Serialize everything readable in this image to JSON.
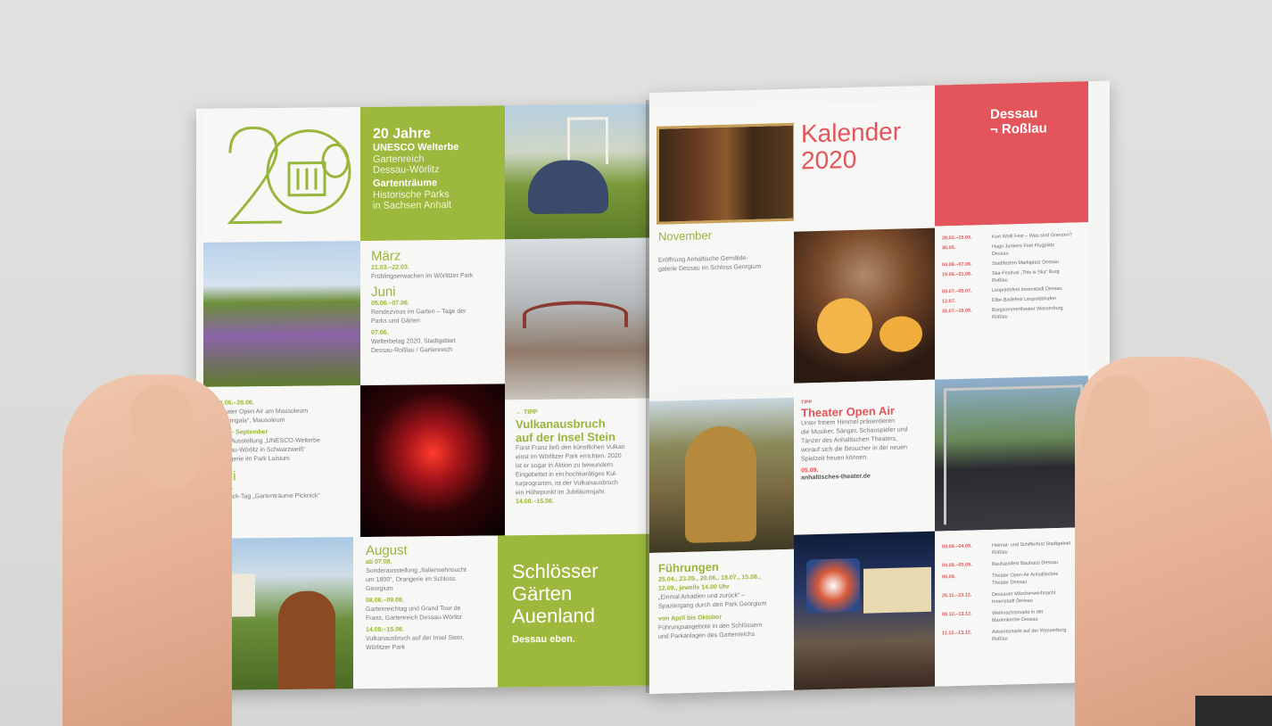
{
  "left_page": {
    "header": {
      "years": "20 Jahre",
      "unesco": "UNESCO Welterbe",
      "garden_line1": "Gartenreich",
      "garden_line2": "Dessau-Wörlitz",
      "dreams": "Gartenträume",
      "parks_line1": "Historische Parks",
      "parks_line2": "in Sachsen Anhalt"
    },
    "march": {
      "month": "März",
      "date1": "21.03.–22.03.",
      "text1": "Frühlingserwachen im Wörlitzer Park"
    },
    "june": {
      "month": "Juni",
      "date1": "05.06.–07.06.",
      "text1a": "Rendezvous im Garten – Tage der",
      "text1b": "Parks und Gärten",
      "date2": "07.06.",
      "text2a": "Welterbetag 2020, Stadtgebiet",
      "text2b": "Dessau-Roßlau / Gartenreich"
    },
    "theatre_block": {
      "date1": "26.06.–28.06.",
      "text1a": "Theater Open Air am Mausoleum",
      "text1b": "„Operngala“, Mausoleum",
      "date2": "Juni – September",
      "text2a": "Foto-Ausstellung „UNESCO-Welterbe",
      "text2b": "Dessau-Wörlitz in Schwarzweiß“",
      "text2c": "Orangerie im Park Luisium",
      "month": "Juli",
      "date3": "29.07.",
      "text3": "Picknick-Tag „Gartenträume Picknick“"
    },
    "tip": {
      "label": "← TIPP",
      "title_line1": "Vulkanausbruch",
      "title_line2": "auf der Insel Stein",
      "text1": "Fürst Franz ließ den künstlichen Vulkan",
      "text2": "einst im Wörlitzer Park errichten. 2020",
      "text3": "ist er sogar in Aktion zu bewundern.",
      "text4": "Eingebettet in ein hochkarätiges Kul-",
      "text5": "turprogramm, ist der Vulkanausbruch",
      "text6": "ein Höhepunkt im Jubiläumsjahr.",
      "date": "14.08.–15.08."
    },
    "august": {
      "month": "August",
      "date1": "ab 07.08.",
      "text1a": "Sonderausstellung „Italiensehnsucht",
      "text1b": "um 1800“, Orangerie im Schloss",
      "text1c": "Georgium",
      "date2": "08.08.–09.08.",
      "text2a": "Gartenreichtag und Grand Tour de",
      "text2b": "Franz, Gartenreich Dessau-Wörlitz",
      "date3": "14.08.–15.08.",
      "text3a": "Vulkanausbruch auf der Insel Stein,",
      "text3b": "Wörlitzer Park"
    },
    "slogan": {
      "line1": "Schlösser",
      "line2": "Gärten",
      "line3": "Auenland",
      "tagline": "Dessau eben."
    }
  },
  "right_page": {
    "title_line1": "Kalender",
    "title_line2": "2020",
    "brand_line1": "Dessau",
    "brand_line2": "¬ Roßlau",
    "november": {
      "month": "November",
      "text1": "Eröffnung Anhaltische Gemälde-",
      "text2": "galerie Dessau im Schloss Georgium"
    },
    "events_top": [
      {
        "date": "28.02.–15.03.",
        "text": "Kurt Weill Fest – Was sind Grenzen?"
      },
      {
        "date": "30.05.",
        "text": "Hugo Junkers Fest Flugplatz Dessau"
      },
      {
        "date": "04.06.–07.06.",
        "text": "Stadtfesten Marktplatz Dessau"
      },
      {
        "date": "19.06.–21.06.",
        "text": "Ska-Festival „This is Ska“ Burg Roßlau"
      },
      {
        "date": "03.07.–05.07.",
        "text": "Leopoldsfest Innenstadt Dessau"
      },
      {
        "date": "12.07.",
        "text": "Elbe-Badefest Leopoldshafen"
      },
      {
        "date": "31.07.–16.08.",
        "text": "Burgsommertheater Wasserburg Roßlau"
      }
    ],
    "tip": {
      "label": "TIPP",
      "title": "Theater Open Air",
      "text1": "Unter freiem Himmel präsentieren",
      "text2": "die Musiker, Sänger, Schauspieler und",
      "text3": "Tänzer des Anhaltischen Theaters,",
      "text4": "worauf sich die Besucher in der neuen",
      "text5": "Spielzeit freuen können.",
      "date": "05.09.",
      "url": "anhaltisches-theater.de"
    },
    "tours": {
      "title": "Führungen",
      "dates1": "25.04., 23.05., 20.06., 18.07., 15.08.,",
      "dates2": "12.09., jeweils 14.00 Uhr",
      "text1": "„Einmal Arkadien und zurück“ –",
      "text2": "Spaziergang durch den Park Georgium",
      "date3": "von April bis Oktober",
      "text3": "Führungsangebote in den Schlössern",
      "text4": "und Parkanlagen des Gartenreichs"
    },
    "events_bottom": [
      {
        "date": "03.09.–04.09.",
        "text": "Heimat- und Schifferfest Stadtgebiet Roßlau"
      },
      {
        "date": "04.09.–05.09.",
        "text": "Bauhausfest Bauhaus Dessau"
      },
      {
        "date": "05.09.",
        "text": "Theater Open Air Anhaltisches Theater Dessau"
      },
      {
        "date": "25.11.–23.12.",
        "text": "Dessauer Märchenweihnacht Innenstadt Dessau"
      },
      {
        "date": "08.12.–13.12.",
        "text": "Weihnachtsmarkt in der Marienkirche Dessau"
      },
      {
        "date": "11.12.–13.12.",
        "text": "Adventsmarkt auf der Wasserburg Roßlau"
      }
    ]
  },
  "colors": {
    "green": "#9cb93d",
    "red": "#e3555a",
    "paper": "#f5f5f3",
    "background": "#d8d8d6"
  }
}
